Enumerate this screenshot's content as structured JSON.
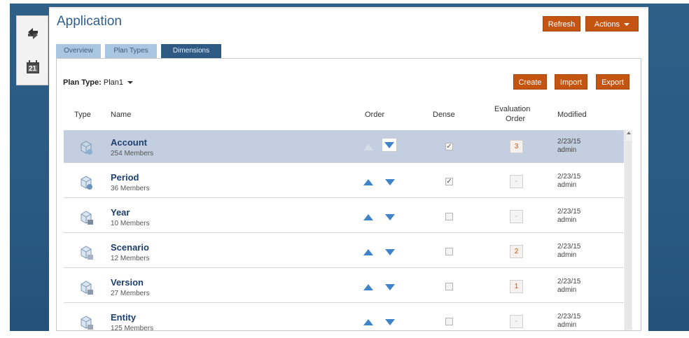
{
  "app": {
    "title": "Application"
  },
  "toolbar": {
    "refresh_label": "Refresh",
    "actions_label": "Actions"
  },
  "tabs": [
    {
      "label": "Overview",
      "active": false
    },
    {
      "label": "Plan Types",
      "active": false
    },
    {
      "label": "Dimensions",
      "active": true
    }
  ],
  "plan": {
    "label": "Plan Type:",
    "value": "Plan1"
  },
  "content_buttons": {
    "create": "Create",
    "import": "Import",
    "export": "Export"
  },
  "columns": {
    "type": "Type",
    "name": "Name",
    "order": "Order",
    "dense": "Dense",
    "eval_line1": "Evaluation",
    "eval_line2": "Order",
    "modified": "Modified"
  },
  "rows": [
    {
      "name": "Account",
      "members": "254 Members",
      "dense": true,
      "eval": "3",
      "date": "2/23/15",
      "user": "admin",
      "selected": true
    },
    {
      "name": "Period",
      "members": "36 Members",
      "dense": true,
      "eval": "-",
      "date": "2/23/15",
      "user": "admin",
      "selected": false
    },
    {
      "name": "Year",
      "members": "10 Members",
      "dense": false,
      "eval": "-",
      "date": "2/23/15",
      "user": "admin",
      "selected": false
    },
    {
      "name": "Scenario",
      "members": "12 Members",
      "dense": false,
      "eval": "2",
      "date": "2/23/15",
      "user": "admin",
      "selected": false
    },
    {
      "name": "Version",
      "members": "27 Members",
      "dense": false,
      "eval": "1",
      "date": "2/23/15",
      "user": "admin",
      "selected": false
    },
    {
      "name": "Entity",
      "members": "125 Members",
      "dense": false,
      "eval": "-",
      "date": "2/23/15",
      "user": "admin",
      "selected": false
    }
  ],
  "icons": {
    "rail_sync": "sync-icon",
    "rail_calendar": "calendar-icon",
    "calendar_day": "21",
    "dimension": "cube-icon"
  },
  "colors": {
    "accent": "#c45412",
    "header": "#2f5f8a",
    "selected_row": "#c3cfe0"
  }
}
